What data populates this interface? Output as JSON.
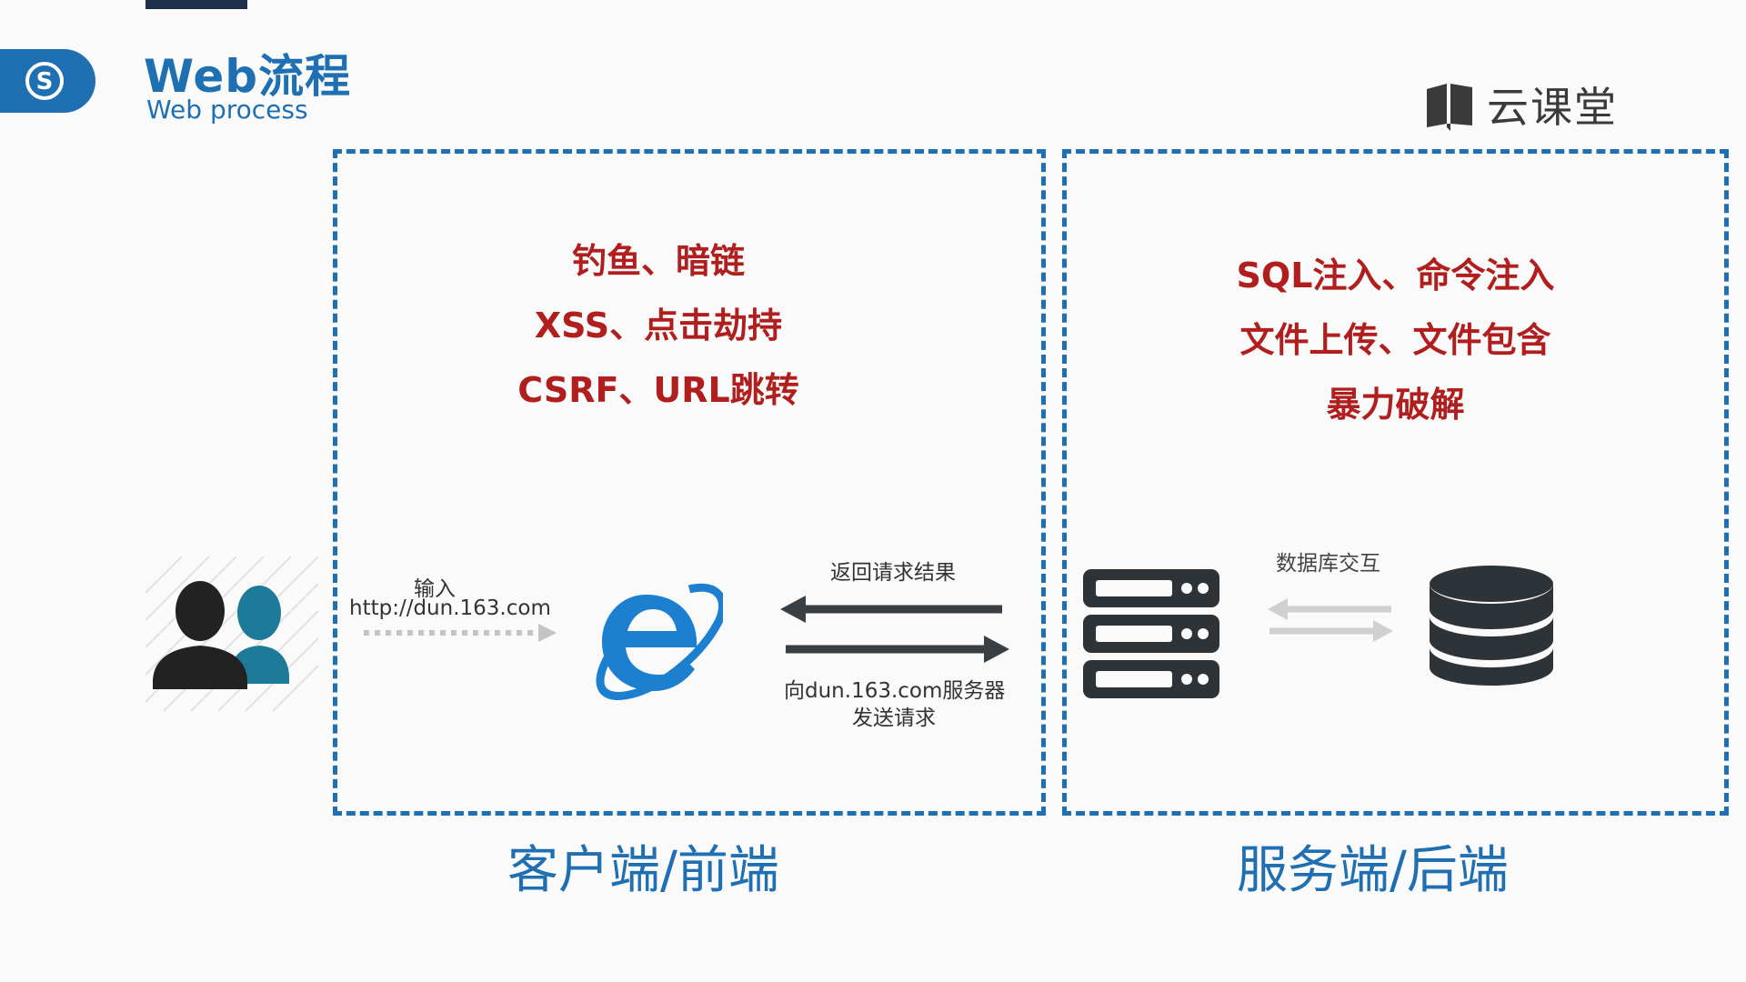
{
  "header": {
    "title_cn": "Web流程",
    "title_en": "Web process",
    "logo_text": "云课堂"
  },
  "client": {
    "threats": [
      "钓鱼、暗链",
      "XSS、点击劫持",
      "CSRF、URL跳转"
    ],
    "zone_label": "客户端/前端",
    "input_label": "输入",
    "url_label": "http://dun.163.com",
    "return_label": "返回请求结果",
    "send_label_line1": "向dun.163.com服务器",
    "send_label_line2": "发送请求"
  },
  "server": {
    "threats": [
      "SQL注入、命令注入",
      "文件上传、文件包含",
      "暴力破解"
    ],
    "zone_label": "服务端/后端",
    "db_label": "数据库交互"
  },
  "colors": {
    "accent_blue": "#1f6fb3",
    "threat_red": "#b01e1e",
    "icon_dark": "#2e3338",
    "user_teal": "#1e7a99"
  },
  "icons": [
    "s-badge-icon",
    "users-icon",
    "ie-browser-icon",
    "server-icon",
    "database-icon",
    "book-logo-icon"
  ]
}
